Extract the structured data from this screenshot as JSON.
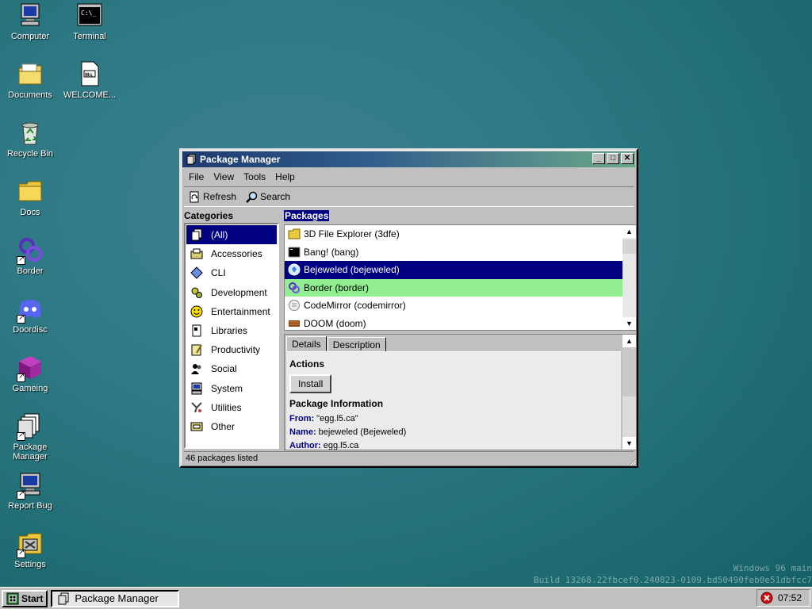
{
  "desktop_icons": [
    {
      "label": "Computer",
      "icon": "computer-icon"
    },
    {
      "label": "Terminal",
      "icon": "terminal-icon"
    },
    {
      "label": "Documents",
      "icon": "documents-folder-icon"
    },
    {
      "label": "WELCOME...",
      "icon": "markdown-file-icon"
    },
    {
      "label": "Recycle Bin",
      "icon": "recycle-bin-icon"
    },
    {
      "label": "Docs",
      "icon": "folder-icon"
    },
    {
      "label": "Border",
      "icon": "border-app-icon"
    },
    {
      "label": "Doordisc",
      "icon": "discord-icon"
    },
    {
      "label": "Gameing",
      "icon": "cube-icon"
    },
    {
      "label": "Package Manager",
      "icon": "package-manager-icon"
    },
    {
      "label": "Report Bug",
      "icon": "bug-report-icon"
    },
    {
      "label": "Settings",
      "icon": "settings-icon"
    }
  ],
  "window": {
    "title": "Package Manager",
    "menu": [
      "File",
      "View",
      "Tools",
      "Help"
    ],
    "toolbar": {
      "refresh_label": "Refresh",
      "search_label": "Search"
    },
    "categories_title": "Categories",
    "categories": [
      {
        "label": "(All)",
        "icon": "all-icon",
        "selected": true
      },
      {
        "label": "Accessories",
        "icon": "accessories-icon"
      },
      {
        "label": "CLI",
        "icon": "cli-icon"
      },
      {
        "label": "Development",
        "icon": "development-icon"
      },
      {
        "label": "Entertainment",
        "icon": "smiley-icon"
      },
      {
        "label": "Libraries",
        "icon": "libraries-icon"
      },
      {
        "label": "Productivity",
        "icon": "productivity-icon"
      },
      {
        "label": "Social",
        "icon": "social-icon"
      },
      {
        "label": "System",
        "icon": "system-icon"
      },
      {
        "label": "Utilities",
        "icon": "utilities-icon"
      },
      {
        "label": "Other",
        "icon": "other-icon"
      }
    ],
    "packages_title": "Packages",
    "packages": [
      {
        "label": "3D File Explorer (3dfe)",
        "icon": "folder-icon"
      },
      {
        "label": "Bang! (bang)",
        "icon": "terminal-icon"
      },
      {
        "label": "Bejeweled (bejeweled)",
        "icon": "gem-icon",
        "selected": true
      },
      {
        "label": "Border (border)",
        "icon": "border-app-icon",
        "hover": true
      },
      {
        "label": "CodeMirror (codemirror)",
        "icon": "codemirror-icon"
      },
      {
        "label": "DOOM (doom)",
        "icon": "doom-icon"
      }
    ],
    "tabs": [
      "Details",
      "Description"
    ],
    "details": {
      "actions_heading": "Actions",
      "install_label": "Install",
      "info_heading": "Package Information",
      "from_key": "From:",
      "from_value": "\"egg.l5.ca\"",
      "name_key": "Name:",
      "name_value": "bejeweled (Bejeweled)",
      "author_key": "Author:",
      "author_value": "egg.l5.ca"
    },
    "status": "46 packages listed"
  },
  "build_info": {
    "line1": "Windows 96 main",
    "line2": "Build 13268.22fbcef0.240823-0109.bd50490feb0e51dbfcc7"
  },
  "taskbar": {
    "start_label": "Start",
    "task_label": "Package Manager",
    "clock": "07:52"
  }
}
